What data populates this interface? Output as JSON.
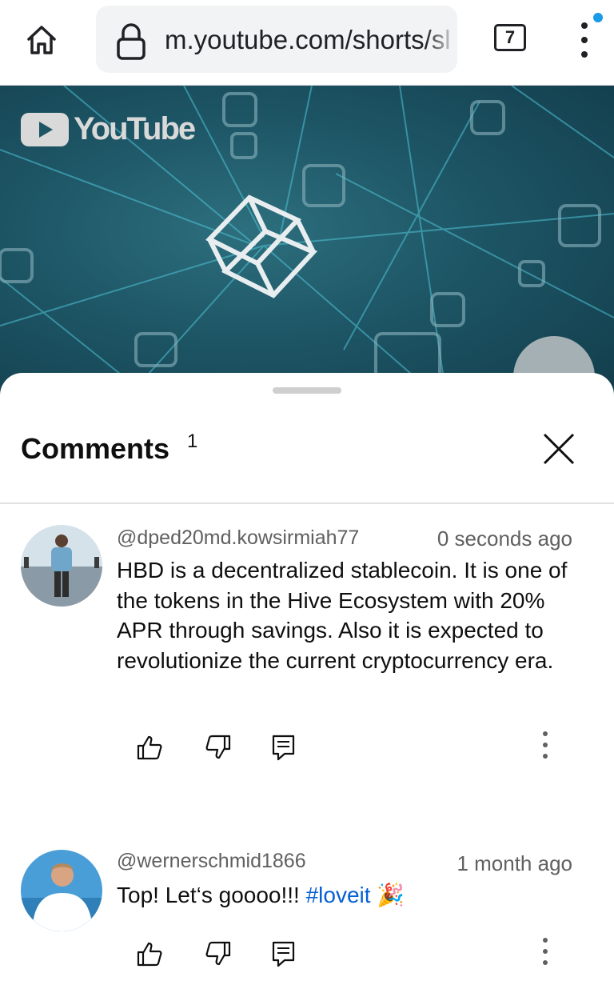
{
  "browser": {
    "url": "m.youtube.com/shorts/sl",
    "tab_count": "7",
    "icons": [
      "home-icon",
      "lock-icon",
      "tabs-icon",
      "more-vert-icon"
    ]
  },
  "video": {
    "logo_text": "YouTube"
  },
  "comments_panel": {
    "title": "Comments",
    "count": "1"
  },
  "comments": [
    {
      "author": "@dped20md.kowsirmiah77",
      "time": "0 seconds ago",
      "text": "HBD is a decentralized stablecoin.  It is one of the tokens in the Hive Ecosystem with 20% APR through savings.  Also it is expected to revolutionize the current cryptocurrency era."
    },
    {
      "author": "@wernerschmid1866",
      "time": "1 month ago",
      "text": "Top! Let‘s goooo!!! ",
      "hashtag": "#loveit",
      "emoji": "🎉"
    }
  ],
  "colors": {
    "accent_blue": "#065fd4",
    "notification_dot": "#1a9be8",
    "video_bg": "#1d5565"
  }
}
